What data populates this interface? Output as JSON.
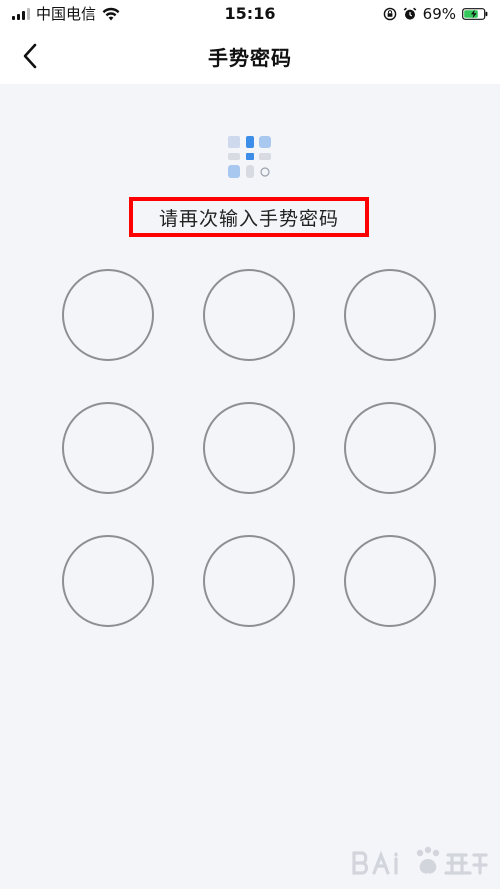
{
  "status_bar": {
    "carrier": "中国电信",
    "time": "15:16",
    "battery_percent": "69%",
    "icons": [
      "signal-icon",
      "wifi-icon",
      "rotation-lock-icon",
      "alarm-icon",
      "battery-charging-icon"
    ]
  },
  "header": {
    "title": "手势密码",
    "back_icon": "chevron-left-icon"
  },
  "main": {
    "prompt": "请再次输入手势密码",
    "preview_pattern": [
      [
        0,
        1,
        1
      ],
      [
        0,
        2,
        0
      ],
      [
        1,
        0,
        0
      ]
    ],
    "gesture_points": 9
  },
  "colors": {
    "accent_blue": "#3d8ee8",
    "highlight_red": "#ff0000",
    "ring_gray": "#8e8e93",
    "background": "#f4f5f9",
    "battery_green": "#34c759"
  },
  "watermark": {
    "logo_icon": "baidu-jingyan-logo-icon"
  }
}
